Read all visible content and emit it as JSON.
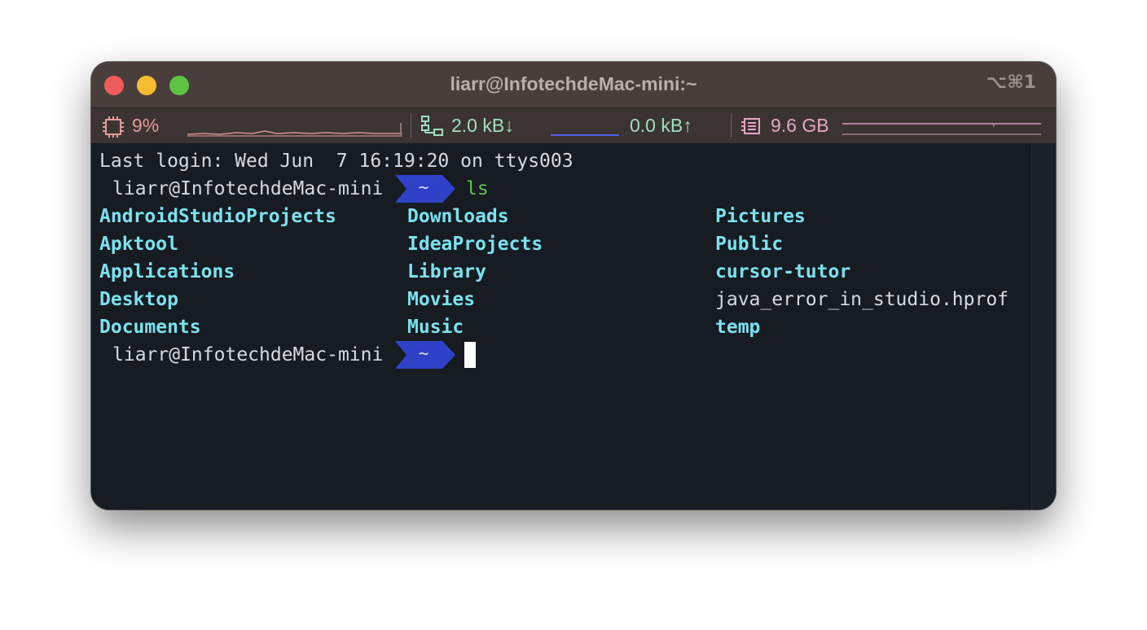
{
  "window": {
    "title": "liarr@InfotechdeMac-mini:~",
    "shortcut": "⌥⌘1",
    "controls": {
      "close": "close-control",
      "minimize": "minimize-control",
      "maximize": "maximize-control"
    }
  },
  "statusbar": {
    "cpu": {
      "icon": "cpu-icon",
      "value": "9%",
      "color": "#e79b96"
    },
    "network": {
      "icon": "network-icon",
      "download": "2.0 kB↓",
      "upload": "0.0 kB↑",
      "color": "#9fdfc1"
    },
    "memory": {
      "icon": "memory-icon",
      "value": "9.6 GB",
      "color": "#e8a5c3"
    }
  },
  "terminal": {
    "last_login": "Last login: Wed Jun  7 16:19:20 on ttys003",
    "prompt_user": "liarr@InfotechdeMac-mini",
    "prompt_dir": "~",
    "command": "ls",
    "ls_columns": [
      [
        "AndroidStudioProjects",
        "Apktool",
        "Applications",
        "Desktop",
        "Documents"
      ],
      [
        "Downloads",
        "IdeaProjects",
        "Library",
        "Movies",
        "Music"
      ],
      [
        "Pictures",
        "Public",
        "cursor-tutor",
        "java_error_in_studio.hprof",
        "temp"
      ]
    ],
    "file_entries": [
      "java_error_in_studio.hprof"
    ],
    "colors": {
      "directory": "#7be1ef",
      "command": "#59c64a",
      "badge": "#2f42c7",
      "background": "#171b22"
    }
  }
}
